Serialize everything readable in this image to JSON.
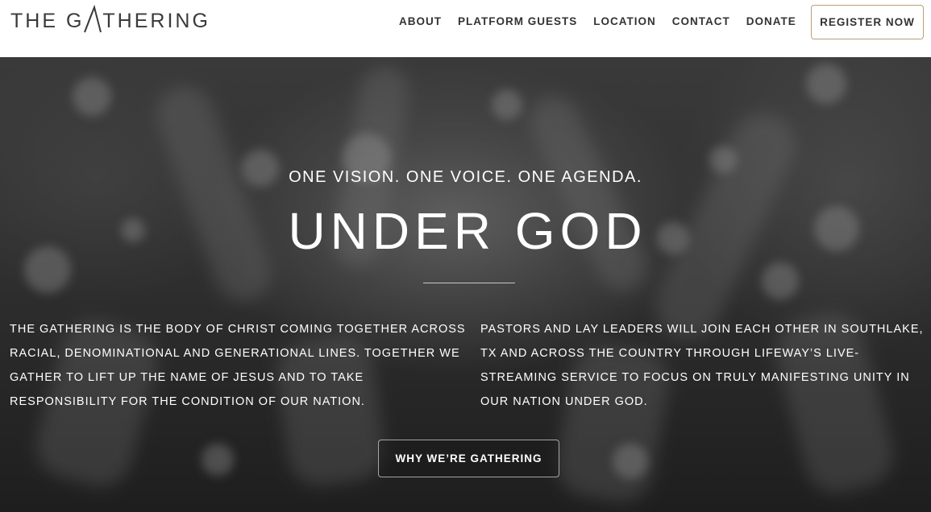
{
  "header": {
    "logo_text_left": "THE G",
    "logo_text_right": "THERING",
    "nav": [
      {
        "label": "ABOUT"
      },
      {
        "label": "PLATFORM GUESTS"
      },
      {
        "label": "LOCATION"
      },
      {
        "label": "CONTACT"
      },
      {
        "label": "DONATE"
      }
    ],
    "cta_label": "REGISTER NOW"
  },
  "hero": {
    "tagline": "ONE VISION. ONE VOICE. ONE AGENDA.",
    "headline": "UNDER GOD",
    "left_paragraph": "THE GATHERING IS THE BODY OF CHRIST COMING TOGETHER ACROSS RACIAL, DENOMINATIONAL AND GENERATIONAL LINES. TOGETHER WE GATHER TO LIFT UP THE NAME OF JESUS AND TO TAKE RESPONSIBILITY FOR THE CONDITION OF OUR NATION.",
    "right_paragraph": "PASTORS AND LAY LEADERS WILL JOIN EACH OTHER IN SOUTHLAKE, TX AND ACROSS THE COUNTRY THROUGH LIFEWAY’S LIVE-STREAMING SERVICE TO FOCUS ON TRULY MANIFESTING UNITY IN OUR NATION UNDER GOD.",
    "button_label": "WHY WE’RE GATHERING"
  },
  "colors": {
    "header_bg": "#ffffff",
    "nav_text": "#333333",
    "cta_border": "#b89e7a",
    "hero_text": "#ffffff"
  }
}
